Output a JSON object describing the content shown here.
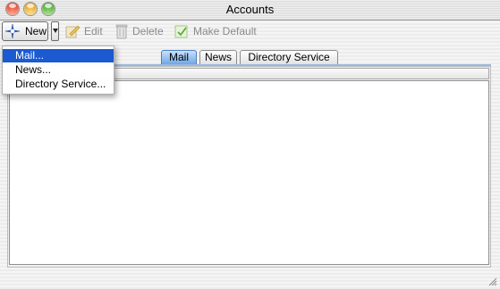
{
  "window": {
    "title": "Accounts"
  },
  "toolbar": {
    "new_label": "New",
    "edit_label": "Edit",
    "delete_label": "Delete",
    "make_default_label": "Make Default"
  },
  "new_menu": {
    "items": [
      "Mail...",
      "News...",
      "Directory Service..."
    ],
    "highlighted_index": 0
  },
  "tabs": {
    "items": [
      "Mail",
      "News",
      "Directory Service"
    ],
    "selected": "Mail"
  },
  "colors": {
    "menu_highlight": "#1b5ad1",
    "tab_active": "#6fa6e6"
  }
}
